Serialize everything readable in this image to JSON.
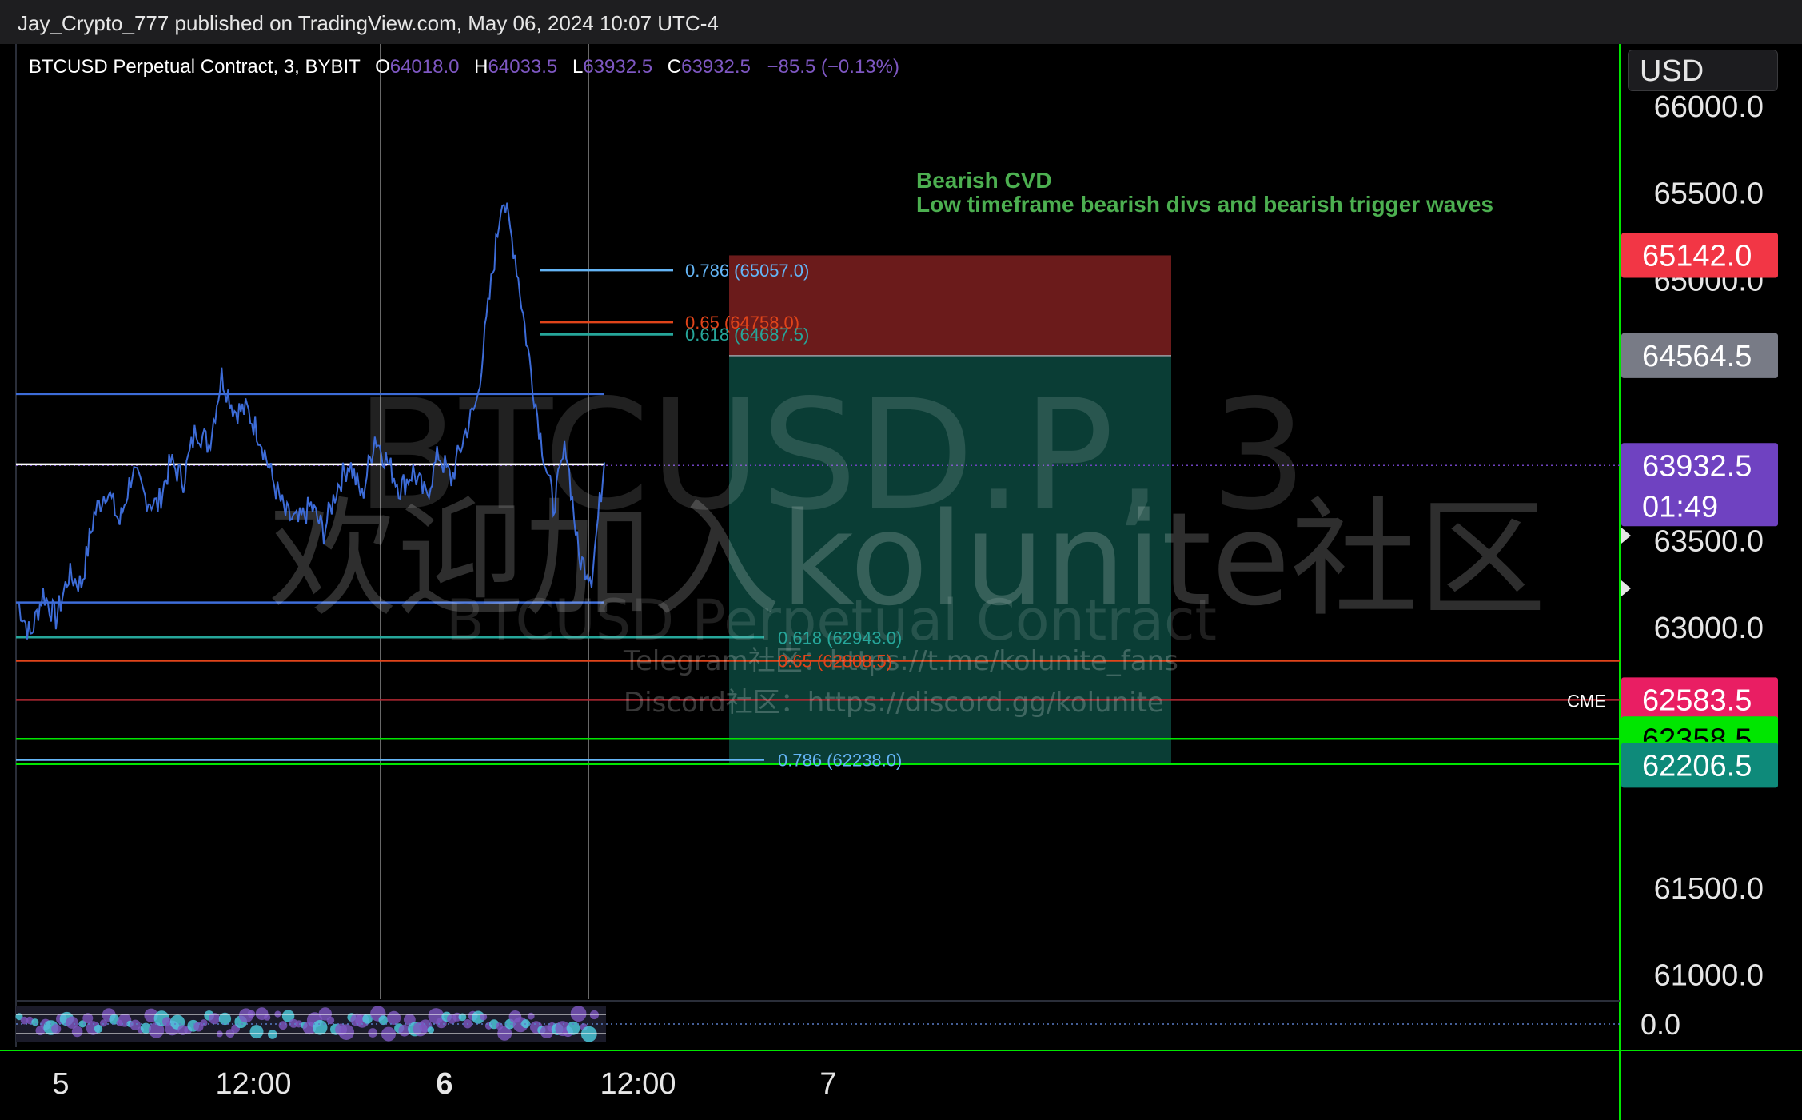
{
  "header": {
    "publish_line": "Jay_Crypto_777 published on TradingView.com, May 06, 2024 10:07 UTC-4"
  },
  "legend": {
    "symbol": "BTCUSD Perpetual Contract, 3, BYBIT",
    "o_key": "O",
    "o_val": "64018.0",
    "h_key": "H",
    "h_val": "64033.5",
    "l_key": "L",
    "l_val": "63932.5",
    "c_key": "C",
    "c_val": "63932.5",
    "change": "−85.5 (−0.13%)"
  },
  "currency": "USD",
  "annotation": {
    "line1": "Bearish CVD",
    "line2": "Low timeframe bearish divs and bearish  trigger waves"
  },
  "watermark": {
    "big": "BTCUSD.P, 3",
    "sub": "BTCUSD Perpetual Contract",
    "cn": "欢迎加入kolunite社区",
    "telegram": "Telegram社区：https://t.me/kolunite_fans",
    "discord": "Discord社区：https://discord.gg/kolunite"
  },
  "colors": {
    "background": "#000000",
    "price_line": "#3d6cd8",
    "accent_green": "#00e600",
    "stop_zone": "#6b1b1b",
    "target_zone": "#0a3d35",
    "current_price": "#6f42c1"
  },
  "chart_data": {
    "type": "line",
    "series_label": "BTCUSD.P 3m",
    "x_ticks": [
      "5",
      "12:00",
      "6",
      "12:00",
      "7"
    ],
    "ylim": [
      60750,
      66300
    ],
    "y_ticks": [
      "66000.0",
      "65500.0",
      "65000.0",
      "63500.0",
      "63000.0",
      "61500.0",
      "61000.0"
    ],
    "price_path": [
      63150,
      62950,
      63200,
      63050,
      63300,
      63250,
      63650,
      63800,
      63600,
      63900,
      63750,
      63700,
      63950,
      63850,
      64150,
      64050,
      64450,
      64250,
      64250,
      64100,
      63850,
      63650,
      63600,
      63700,
      63550,
      63800,
      63950,
      63750,
      64100,
      63950,
      63800,
      63900,
      63750,
      64000,
      63850,
      64100,
      64300,
      64900,
      65500,
      65150,
      64600,
      64100,
      63700,
      64050,
      63400,
      63300,
      63950
    ],
    "horizontal_levels": [
      {
        "price": 64344,
        "color": "#3d6cd8"
      },
      {
        "price": 63939,
        "color": "#ffffff"
      },
      {
        "price": 63144,
        "color": "#3d6cd8"
      },
      {
        "price": 62943,
        "color": "#26a69a"
      },
      {
        "price": 62808.5,
        "color": "#e0441a"
      },
      {
        "price": 62583.5,
        "color": "#b22833"
      },
      {
        "price": 62358.5,
        "color": "#00e600"
      },
      {
        "price": 62238,
        "color": "#64b5f6"
      },
      {
        "price": 62213.5,
        "color": "#00e600"
      }
    ],
    "fib_levels": [
      {
        "label": "0.786 (65057.0)",
        "price": 65057.0,
        "color": "#64b5f6"
      },
      {
        "label": "0.65 (64758.0)",
        "price": 64758.0,
        "color": "#e0441a"
      },
      {
        "label": "0.618 (64687.5)",
        "price": 64687.5,
        "color": "#26a69a"
      },
      {
        "label": "0.618 (62943.0)",
        "price": 62943.0,
        "color": "#26a69a"
      },
      {
        "label": "0.65 (62808.5)",
        "price": 62808.5,
        "color": "#e0441a"
      },
      {
        "label": "0.786 (62238.0)",
        "price": 62238.0,
        "color": "#64b5f6"
      }
    ],
    "position": {
      "stop": 65142.0,
      "entry": 64564.5,
      "target": 62213.5
    },
    "price_labels": [
      {
        "text": "65142.0",
        "price": 65142.0,
        "bg": "#f23645",
        "fg": "#ffffff"
      },
      {
        "text": "64564.5",
        "price": 64564.5,
        "bg": "#787b86",
        "fg": "#ffffff"
      },
      {
        "text": "63932.5",
        "sub": "01:49",
        "price": 63932.5,
        "bg": "#6f42c1",
        "fg": "#ffffff"
      },
      {
        "text": "62583.5",
        "price": 62583.5,
        "bg": "#e91e63",
        "fg": "#ffffff"
      },
      {
        "text": "62358.5",
        "price": 62358.5,
        "bg": "#00e600",
        "fg": "#000000"
      },
      {
        "text": "62213.5",
        "price": 62213.5,
        "bg": "#00e600",
        "fg": "#000000"
      },
      {
        "text": "62206.5",
        "price": 62206.5,
        "bg": "#0e8a7a",
        "fg": "#ffffff"
      }
    ],
    "cme_label": "CME",
    "oscillator_zero": "0.0"
  }
}
